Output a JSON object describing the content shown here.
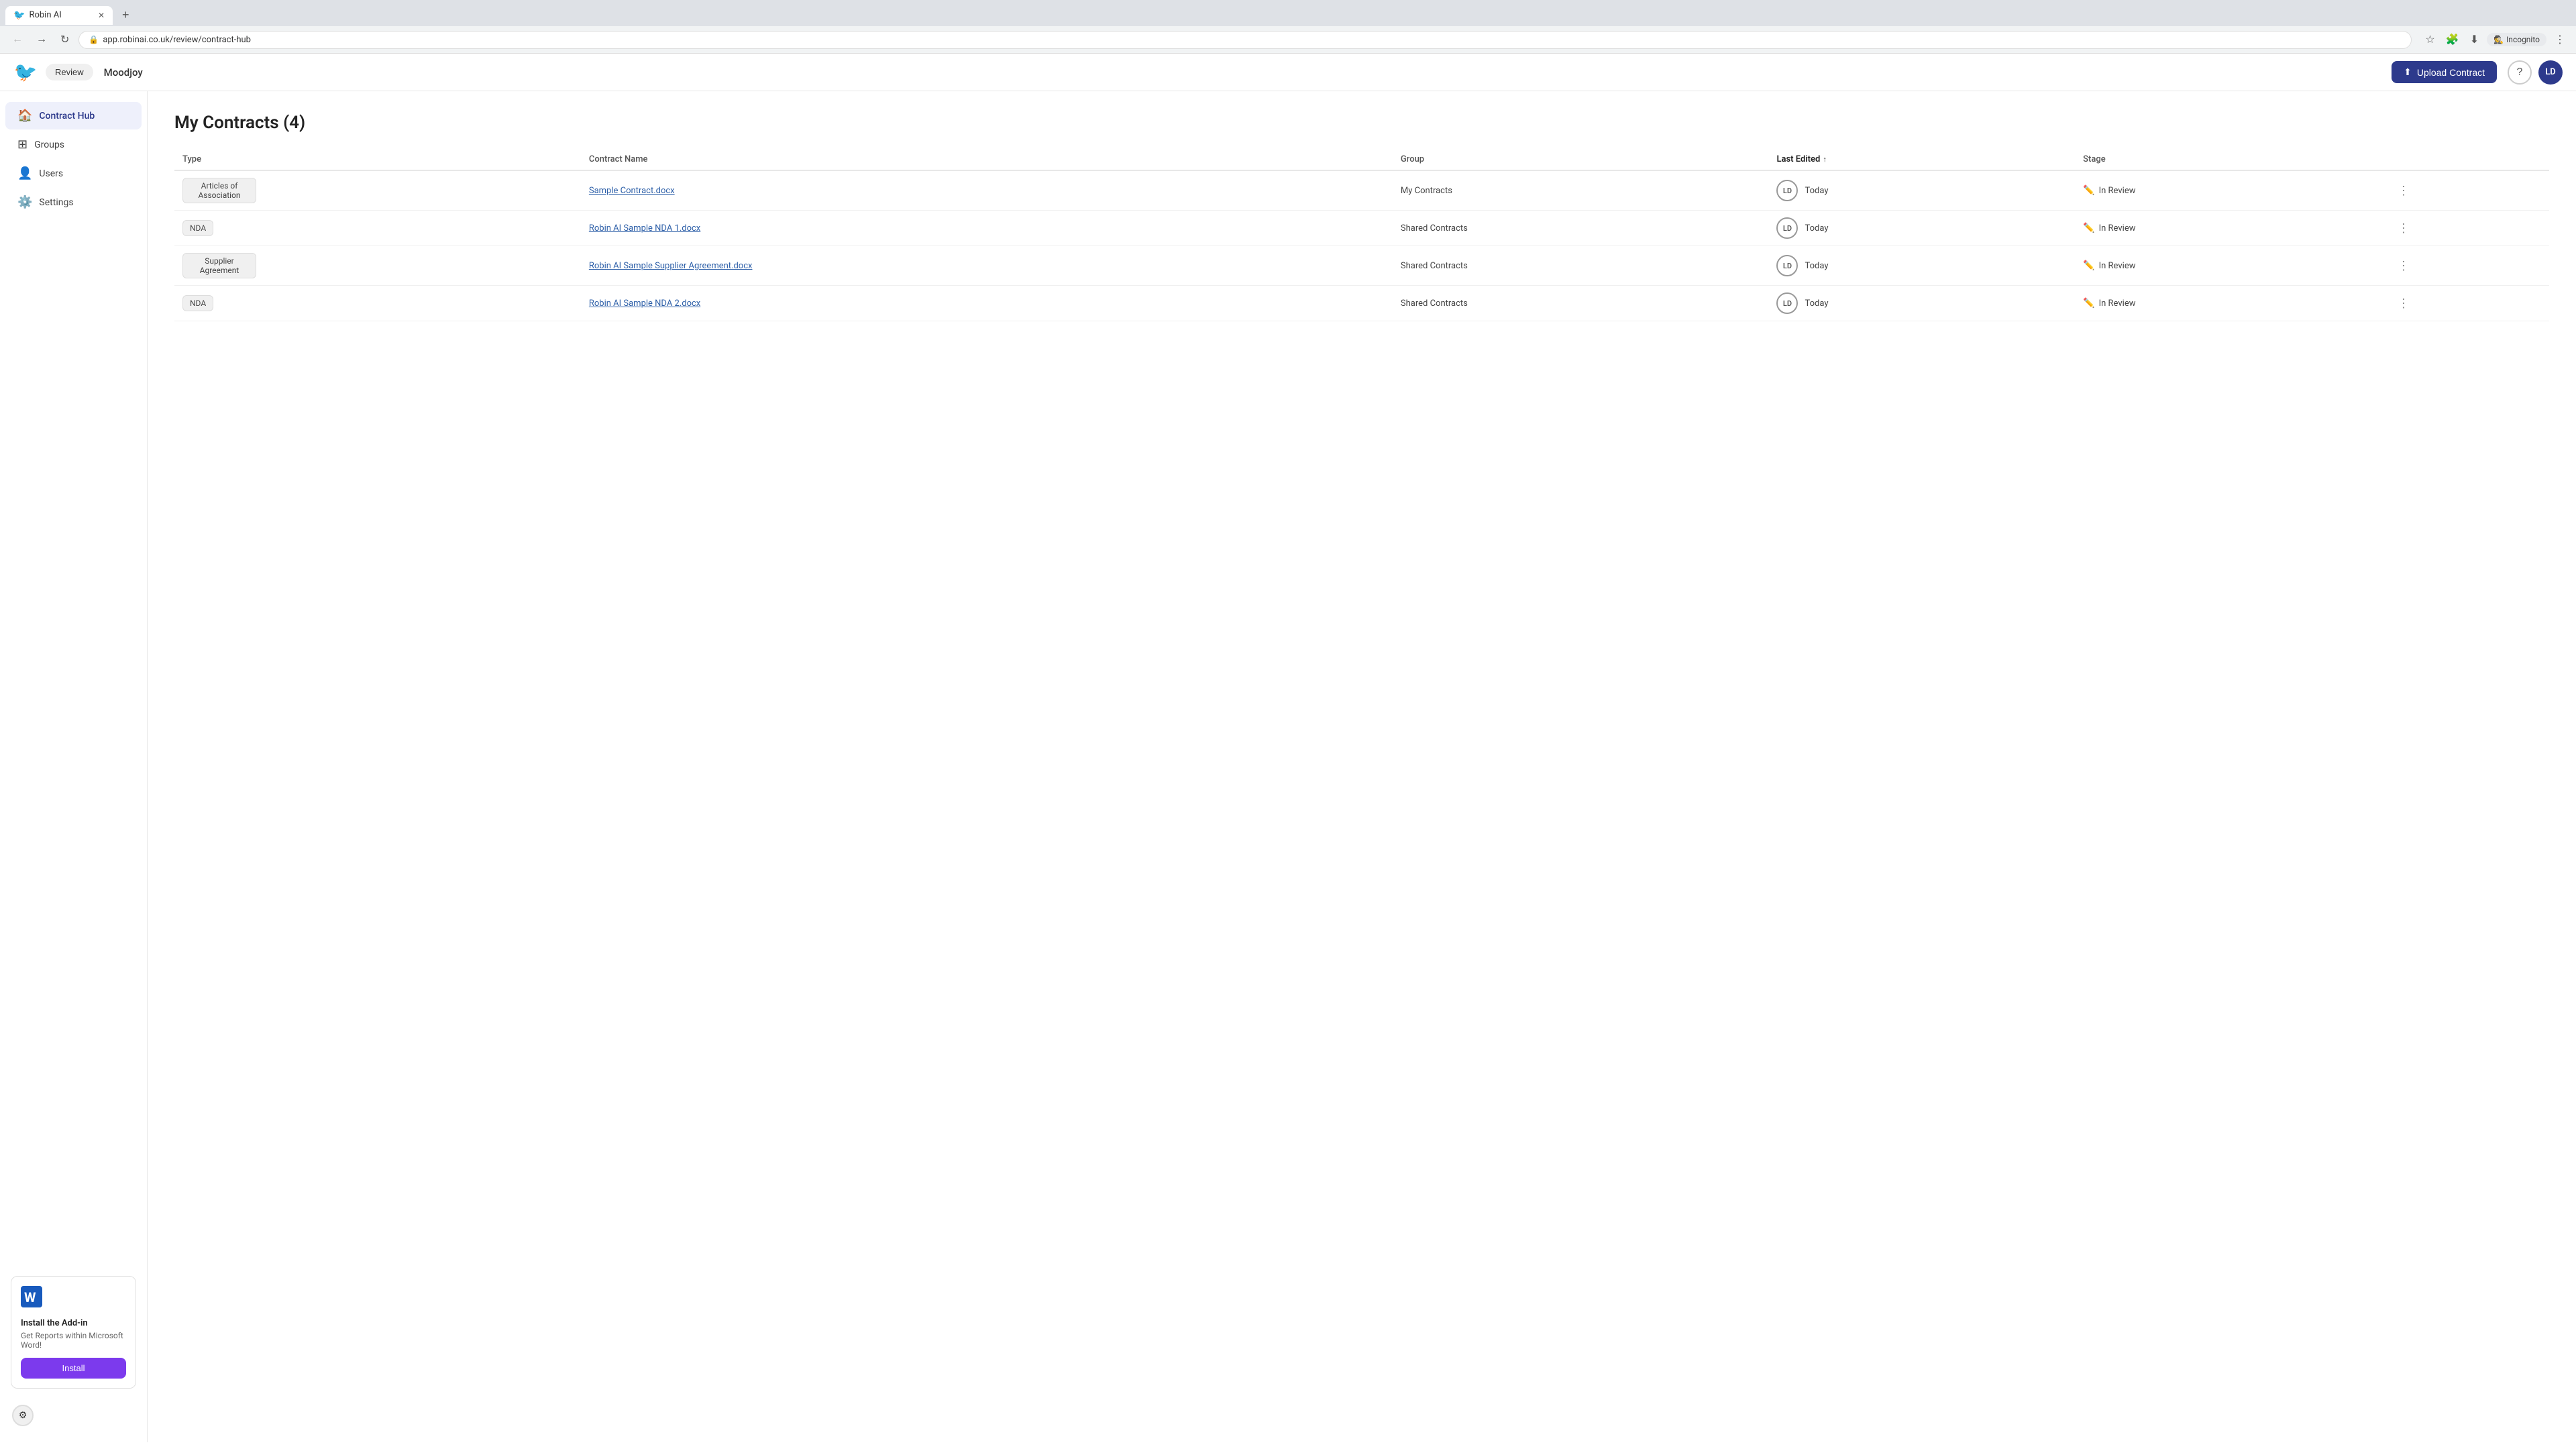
{
  "browser": {
    "tab_title": "Robin AI",
    "tab_favicon": "🐦",
    "address": "app.robinai.co.uk/review/contract-hub",
    "incognito_label": "Incognito"
  },
  "header": {
    "review_label": "Review",
    "app_title": "Moodjoy",
    "upload_button_label": "Upload Contract",
    "user_initials": "LD"
  },
  "sidebar": {
    "nav_items": [
      {
        "label": "Contract Hub",
        "icon": "🏠",
        "active": true
      },
      {
        "label": "Groups",
        "icon": "⊞",
        "active": false
      },
      {
        "label": "Users",
        "icon": "👤",
        "active": false
      },
      {
        "label": "Settings",
        "icon": "⚙️",
        "active": false
      }
    ],
    "addon": {
      "title": "Install the Add-in",
      "description": "Get Reports within Microsoft Word!",
      "install_label": "Install"
    }
  },
  "main": {
    "page_title": "My Contracts (4)",
    "table": {
      "columns": [
        "Type",
        "Contract Name",
        "Group",
        "Last Edited",
        "Stage"
      ],
      "rows": [
        {
          "type": "Articles of Association",
          "contract_name": "Sample Contract.docx",
          "group": "My Contracts",
          "editor_initials": "LD",
          "last_edited": "Today",
          "stage": "In Review"
        },
        {
          "type": "NDA",
          "contract_name": "Robin AI Sample NDA 1.docx",
          "group": "Shared Contracts",
          "editor_initials": "LD",
          "last_edited": "Today",
          "stage": "In Review"
        },
        {
          "type": "Supplier Agreement",
          "contract_name": "Robin AI Sample Supplier Agreement.docx",
          "group": "Shared Contracts",
          "editor_initials": "LD",
          "last_edited": "Today",
          "stage": "In Review"
        },
        {
          "type": "NDA",
          "contract_name": "Robin AI Sample NDA 2.docx",
          "group": "Shared Contracts",
          "editor_initials": "LD",
          "last_edited": "Today",
          "stage": "In Review"
        }
      ]
    }
  }
}
